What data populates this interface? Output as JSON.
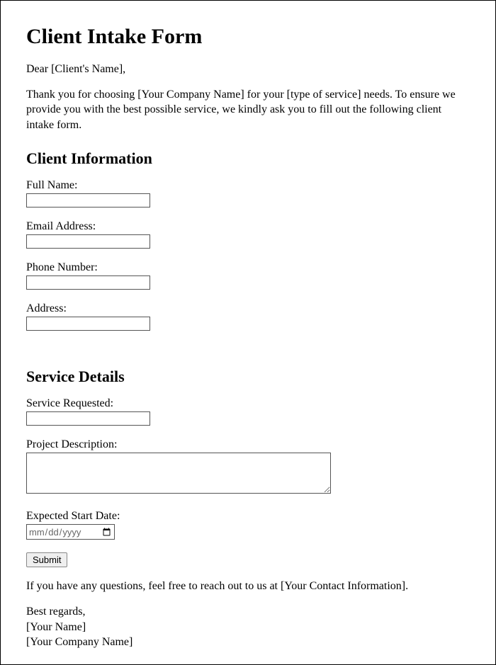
{
  "title": "Client Intake Form",
  "greeting": "Dear [Client's Name],",
  "intro": "Thank you for choosing [Your Company Name] for your [type of service] needs. To ensure we provide you with the best possible service, we kindly ask you to fill out the following client intake form.",
  "sections": {
    "client_info": {
      "heading": "Client Information",
      "fields": {
        "full_name": "Full Name:",
        "email": "Email Address:",
        "phone": "Phone Number:",
        "address": "Address:"
      }
    },
    "service_details": {
      "heading": "Service Details",
      "fields": {
        "service_requested": "Service Requested:",
        "project_description": "Project Description:",
        "expected_start_date": "Expected Start Date:"
      }
    }
  },
  "date_placeholder": "mm/dd/yyyy",
  "submit_label": "Submit",
  "footer_note": "If you have any questions, feel free to reach out to us at [Your Contact Information].",
  "closing": {
    "regards": "Best regards,",
    "name": "[Your Name]",
    "company": "[Your Company Name]"
  }
}
